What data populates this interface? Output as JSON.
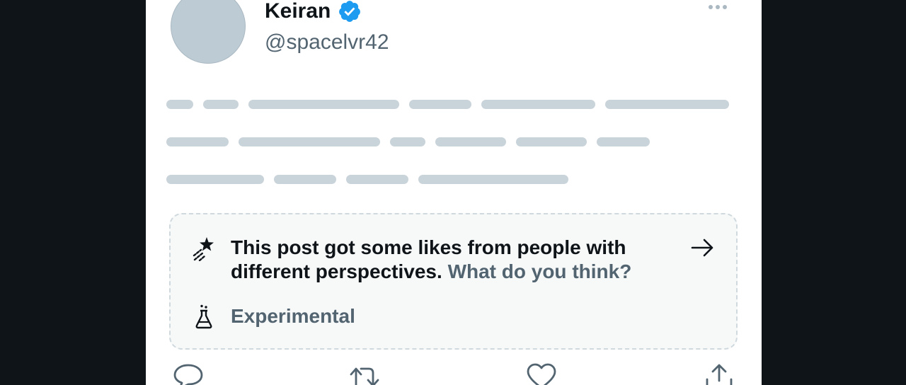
{
  "post": {
    "author_name": "Keiran",
    "author_handle": "@spacelvr42",
    "verified": true,
    "verified_color": "#1d9bf0"
  },
  "notice": {
    "text": "This post got some likes from people with different perspectives.",
    "link_text": "What do you think?",
    "tag_label": "Experimental",
    "icon": "sparkle-star-icon",
    "arrow_icon": "arrow-right-icon",
    "tag_icon": "flask-icon"
  },
  "actions": [
    {
      "name": "reply",
      "icon": "reply-icon"
    },
    {
      "name": "repost",
      "icon": "repost-icon"
    },
    {
      "name": "like",
      "icon": "heart-icon"
    },
    {
      "name": "share",
      "icon": "share-icon"
    }
  ],
  "colors": {
    "placeholder_bar": "#c9d3da",
    "avatar_placeholder": "#bdcbd5",
    "secondary_text": "#536471",
    "background": "#0f1419"
  }
}
